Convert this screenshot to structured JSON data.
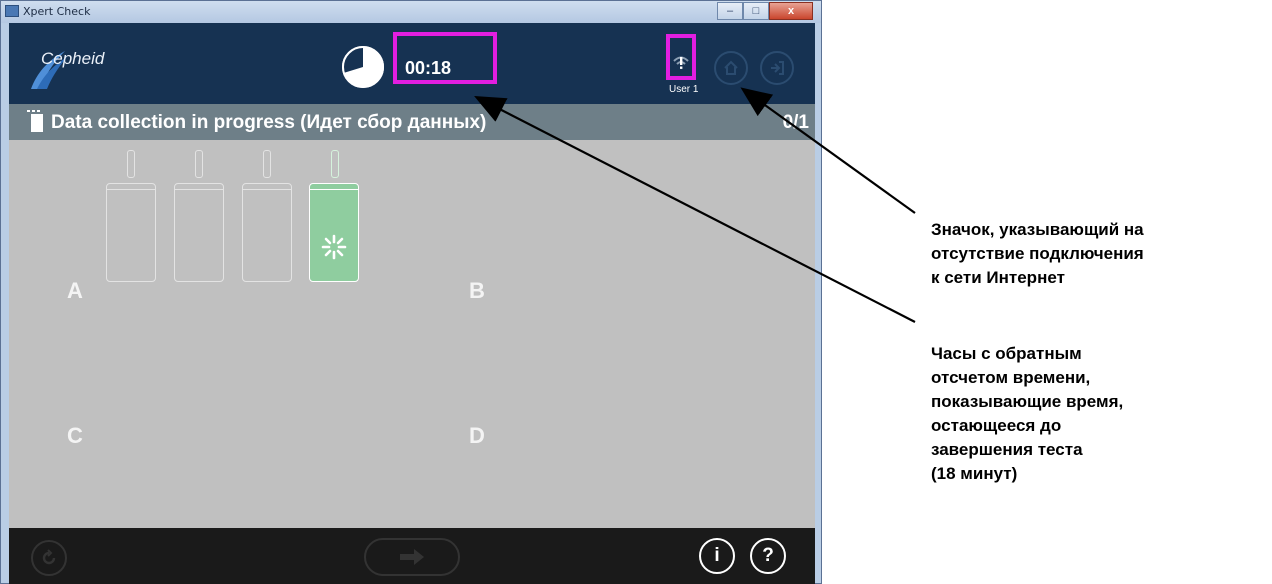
{
  "window": {
    "title": "Xpert Check",
    "controls": {
      "minimize": "–",
      "maximize": "□",
      "close": "x"
    }
  },
  "header": {
    "logo_text": "Cepheid",
    "timer": "00:18",
    "timer_icon": "pie-clock-icon",
    "network_icon": "no-internet-icon",
    "user": "User 1",
    "buttons": [
      "home-icon",
      "exit-icon"
    ]
  },
  "status": {
    "text": "Data collection in progress (Идет сбор данных)",
    "count": "0/1"
  },
  "modules": {
    "labels": [
      "A",
      "B",
      "C",
      "D"
    ],
    "module_a_active_slot": 4,
    "module_a_slots": 4
  },
  "footer": {
    "buttons": [
      "refresh-icon",
      "next-arrow-icon",
      "info-icon",
      "help-icon"
    ],
    "info_label": "i",
    "help_label": "?"
  },
  "annotations": [
    {
      "text": "Значок, указывающий на\nотсутствие подключения\nк сети Интернет"
    },
    {
      "text": "Часы с обратным\nотсчетом времени,\nпоказывающие время,\nостающееся до\nзавершения теста\n(18 минут)"
    }
  ],
  "colors": {
    "header": "#163252",
    "status_bar": "#6e7f88",
    "main_bg": "#c0c0c0",
    "footer": "#1a1a1a",
    "highlight": "#e21ee0",
    "active_slot": "#8fcd9f"
  }
}
